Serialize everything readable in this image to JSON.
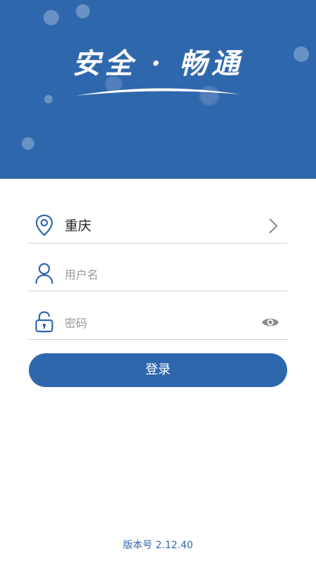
{
  "header": {
    "slogan": "安全 · 畅通",
    "background_color": "#2f67ad"
  },
  "form": {
    "region": {
      "value": "重庆",
      "icon": "location-pin-icon",
      "action_icon": "chevron-right-icon"
    },
    "username": {
      "placeholder": "用户名",
      "icon": "user-icon"
    },
    "password": {
      "placeholder": "密码",
      "icon": "lock-icon",
      "action_icon": "eye-icon"
    },
    "login_label": "登录"
  },
  "footer": {
    "version": "版本号 2.12.40"
  },
  "colors": {
    "accent": "#2f67ad",
    "divider": "#cfcfcf",
    "placeholder": "#9a9a9a"
  }
}
